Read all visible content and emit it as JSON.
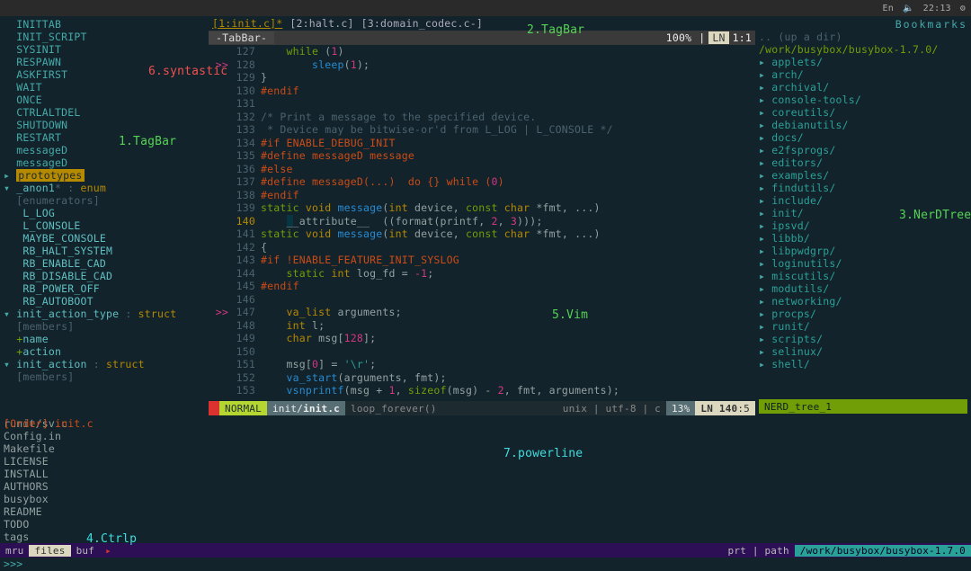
{
  "topbar": {
    "lang": "En",
    "vol": "🔈",
    "time": "22:13",
    "gear": "⚙"
  },
  "tabs": {
    "items": [
      "[1:init.c]*",
      "[2:halt.c]",
      "[3:domain_codec.c-]"
    ],
    "label": "-TabBar-",
    "pct": "100%",
    "ln_lbl": "LN",
    "ln_val": "1:1"
  },
  "tagbar": {
    "lines": [
      {
        "t": "  INITTAB",
        "c": "tb-macro"
      },
      {
        "t": "  INIT_SCRIPT",
        "c": "tb-macro"
      },
      {
        "t": "  SYSINIT",
        "c": "tb-macro"
      },
      {
        "t": "  RESPAWN",
        "c": "tb-macro"
      },
      {
        "t": "  ASKFIRST",
        "c": "tb-macro"
      },
      {
        "t": "  WAIT",
        "c": "tb-macro"
      },
      {
        "t": "  ONCE",
        "c": "tb-macro"
      },
      {
        "t": "  CTRLALTDEL",
        "c": "tb-macro"
      },
      {
        "t": "  SHUTDOWN",
        "c": "tb-macro"
      },
      {
        "t": "  RESTART",
        "c": "tb-macro"
      },
      {
        "t": "  messageD",
        "c": "tb-macro"
      },
      {
        "t": "  messageD",
        "c": "tb-macro"
      },
      {
        "sel": "prototypes",
        "pre": "▸ "
      },
      {
        "raw": [
          {
            "t": "▾ ",
            "c": "tb-arrow"
          },
          {
            "t": "_anon1",
            "c": "tb-name"
          },
          {
            "t": "* : ",
            "c": "tb-muted"
          },
          {
            "t": "enum",
            "c": "tb-type"
          }
        ]
      },
      {
        "t": "  [enumerators]",
        "c": "tb-muted"
      },
      {
        "t": "   L_LOG",
        "c": "tb-name"
      },
      {
        "t": "   L_CONSOLE",
        "c": "tb-name"
      },
      {
        "t": "   MAYBE_CONSOLE",
        "c": "tb-name"
      },
      {
        "t": "   RB_HALT_SYSTEM",
        "c": "tb-name"
      },
      {
        "t": "   RB_ENABLE_CAD",
        "c": "tb-name"
      },
      {
        "t": "   RB_DISABLE_CAD",
        "c": "tb-name"
      },
      {
        "t": "   RB_POWER_OFF",
        "c": "tb-name"
      },
      {
        "t": "   RB_AUTOBOOT",
        "c": "tb-name"
      },
      {
        "raw": [
          {
            "t": "▾ ",
            "c": "tb-arrow"
          },
          {
            "t": "init_action_type",
            "c": "tb-name"
          },
          {
            "t": " : ",
            "c": "tb-muted"
          },
          {
            "t": "struct",
            "c": "tb-type"
          }
        ]
      },
      {
        "t": "  [members]",
        "c": "tb-muted"
      },
      {
        "raw": [
          {
            "t": "  +",
            "c": "tb-plus"
          },
          {
            "t": "name",
            "c": "tb-name"
          }
        ]
      },
      {
        "raw": [
          {
            "t": "  +",
            "c": "tb-plus"
          },
          {
            "t": "action",
            "c": "tb-name"
          }
        ]
      },
      {
        "raw": [
          {
            "t": "▾ ",
            "c": "tb-arrow"
          },
          {
            "t": "init_action",
            "c": "tb-name"
          },
          {
            "t": " : ",
            "c": "tb-muted"
          },
          {
            "t": "struct",
            "c": "tb-type"
          }
        ]
      },
      {
        "t": "  [members]",
        "c": "tb-muted"
      }
    ],
    "status": "[Order] init.c"
  },
  "code": {
    "lines": [
      {
        "m": "",
        "n": "127",
        "seg": [
          {
            "c": "tk-pl",
            "t": "    "
          },
          {
            "c": "tk-kw",
            "t": "while"
          },
          {
            "c": "tk-pl",
            "t": " ("
          },
          {
            "c": "tk-nm",
            "t": "1"
          },
          {
            "c": "tk-pl",
            "t": ")"
          }
        ]
      },
      {
        "m": ">>",
        "n": "128",
        "seg": [
          {
            "c": "tk-pl",
            "t": "        "
          },
          {
            "c": "tk-fn",
            "t": "sleep"
          },
          {
            "c": "tk-pl",
            "t": "("
          },
          {
            "c": "tk-nm",
            "t": "1"
          },
          {
            "c": "tk-pl",
            "t": ");"
          }
        ]
      },
      {
        "m": "",
        "n": "129",
        "seg": [
          {
            "c": "tk-pl",
            "t": "}"
          }
        ]
      },
      {
        "m": "",
        "n": "130",
        "seg": [
          {
            "c": "tk-pp",
            "t": "#endif"
          }
        ]
      },
      {
        "m": "",
        "n": "131",
        "seg": []
      },
      {
        "m": "",
        "n": "132",
        "seg": [
          {
            "c": "tk-cm",
            "t": "/* Print a message to the specified device."
          }
        ]
      },
      {
        "m": "",
        "n": "133",
        "seg": [
          {
            "c": "tk-cm",
            "t": " * Device may be bitwise-or'd from L_LOG | L_CONSOLE */"
          }
        ]
      },
      {
        "m": "",
        "n": "134",
        "seg": [
          {
            "c": "tk-pp",
            "t": "#if ENABLE_DEBUG_INIT"
          }
        ]
      },
      {
        "m": "",
        "n": "135",
        "seg": [
          {
            "c": "tk-pp",
            "t": "#define messageD message"
          }
        ]
      },
      {
        "m": "",
        "n": "136",
        "seg": [
          {
            "c": "tk-pp",
            "t": "#else"
          }
        ]
      },
      {
        "m": "",
        "n": "137",
        "seg": [
          {
            "c": "tk-pp",
            "t": "#define messageD(...)  do {} while ("
          },
          {
            "c": "tk-nm",
            "t": "0"
          },
          {
            "c": "tk-pp",
            "t": ")"
          }
        ]
      },
      {
        "m": "",
        "n": "138",
        "seg": [
          {
            "c": "tk-pp",
            "t": "#endif"
          }
        ]
      },
      {
        "m": "",
        "n": "139",
        "seg": [
          {
            "c": "tk-kw",
            "t": "static "
          },
          {
            "c": "tk-ty",
            "t": "void "
          },
          {
            "c": "tk-fn",
            "t": "message"
          },
          {
            "c": "tk-pl",
            "t": "("
          },
          {
            "c": "tk-ty",
            "t": "int"
          },
          {
            "c": "tk-pl",
            "t": " device, "
          },
          {
            "c": "tk-kw",
            "t": "const "
          },
          {
            "c": "tk-ty",
            "t": "char"
          },
          {
            "c": "tk-pl",
            "t": " *fmt, ...)"
          }
        ]
      },
      {
        "m": "",
        "n": "140",
        "seg": [
          {
            "c": "tk-pl",
            "t": "    "
          },
          {
            "c": "cursor-bg",
            "t": "_"
          },
          {
            "c": "tk-pl",
            "t": "_attribute__  ((format(printf, "
          },
          {
            "c": "tk-nm",
            "t": "2"
          },
          {
            "c": "tk-pl",
            "t": ", "
          },
          {
            "c": "tk-nm",
            "t": "3"
          },
          {
            "c": "tk-pl",
            "t": ")));"
          }
        ],
        "cur": true
      },
      {
        "m": "",
        "n": "141",
        "seg": [
          {
            "c": "tk-kw",
            "t": "static "
          },
          {
            "c": "tk-ty",
            "t": "void "
          },
          {
            "c": "tk-fn",
            "t": "message"
          },
          {
            "c": "tk-pl",
            "t": "("
          },
          {
            "c": "tk-ty",
            "t": "int"
          },
          {
            "c": "tk-pl",
            "t": " device, "
          },
          {
            "c": "tk-kw",
            "t": "const "
          },
          {
            "c": "tk-ty",
            "t": "char"
          },
          {
            "c": "tk-pl",
            "t": " *fmt, ...)"
          }
        ]
      },
      {
        "m": "",
        "n": "142",
        "seg": [
          {
            "c": "tk-pl",
            "t": "{"
          }
        ]
      },
      {
        "m": "",
        "n": "143",
        "seg": [
          {
            "c": "tk-pp",
            "t": "#if !ENABLE_FEATURE_INIT_SYSLOG"
          }
        ]
      },
      {
        "m": "",
        "n": "144",
        "seg": [
          {
            "c": "tk-pl",
            "t": "    "
          },
          {
            "c": "tk-kw",
            "t": "static "
          },
          {
            "c": "tk-ty",
            "t": "int"
          },
          {
            "c": "tk-pl",
            "t": " log_fd = "
          },
          {
            "c": "tk-nm",
            "t": "-1"
          },
          {
            "c": "tk-pl",
            "t": ";"
          }
        ]
      },
      {
        "m": "",
        "n": "145",
        "seg": [
          {
            "c": "tk-pp",
            "t": "#endif"
          }
        ]
      },
      {
        "m": "",
        "n": "146",
        "seg": []
      },
      {
        "m": ">>",
        "n": "147",
        "seg": [
          {
            "c": "tk-pl",
            "t": "    "
          },
          {
            "c": "tk-ty",
            "t": "va_list"
          },
          {
            "c": "tk-pl",
            "t": " arguments;"
          }
        ]
      },
      {
        "m": "",
        "n": "148",
        "seg": [
          {
            "c": "tk-pl",
            "t": "    "
          },
          {
            "c": "tk-ty",
            "t": "int"
          },
          {
            "c": "tk-pl",
            "t": " l;"
          }
        ]
      },
      {
        "m": "",
        "n": "149",
        "seg": [
          {
            "c": "tk-pl",
            "t": "    "
          },
          {
            "c": "tk-ty",
            "t": "char"
          },
          {
            "c": "tk-pl",
            "t": " msg["
          },
          {
            "c": "tk-nm",
            "t": "128"
          },
          {
            "c": "tk-pl",
            "t": "];"
          }
        ]
      },
      {
        "m": "",
        "n": "150",
        "seg": []
      },
      {
        "m": "",
        "n": "151",
        "seg": [
          {
            "c": "tk-pl",
            "t": "    msg["
          },
          {
            "c": "tk-nm",
            "t": "0"
          },
          {
            "c": "tk-pl",
            "t": "] = "
          },
          {
            "c": "tk-ch",
            "t": "'\\r'"
          },
          {
            "c": "tk-pl",
            "t": ";"
          }
        ]
      },
      {
        "m": "",
        "n": "152",
        "seg": [
          {
            "c": "tk-pl",
            "t": "    "
          },
          {
            "c": "tk-fn",
            "t": "va_start"
          },
          {
            "c": "tk-pl",
            "t": "(arguments, fmt);"
          }
        ]
      },
      {
        "m": "",
        "n": "153",
        "seg": [
          {
            "c": "tk-pl",
            "t": "    "
          },
          {
            "c": "tk-fn",
            "t": "vsnprintf"
          },
          {
            "c": "tk-pl",
            "t": "(msg + "
          },
          {
            "c": "tk-nm",
            "t": "1"
          },
          {
            "c": "tk-pl",
            "t": ", "
          },
          {
            "c": "tk-kw",
            "t": "sizeof"
          },
          {
            "c": "tk-pl",
            "t": "(msg) - "
          },
          {
            "c": "tk-nm",
            "t": "2"
          },
          {
            "c": "tk-pl",
            "t": ", fmt, arguments);"
          }
        ]
      }
    ]
  },
  "statusline": {
    "mode": "NORMAL",
    "file_dir": "init/",
    "file_name": "init.c",
    "func": "loop_forever()",
    "enc": "unix | utf-8 | c",
    "pct": "13%",
    "ln_lbl": "LN 140",
    "ln_col": ":5",
    "nerd": "NERD_tree_1"
  },
  "nerdtree": {
    "title": "Bookmarks",
    "up": ".. (up a dir)",
    "root": "/work/busybox/busybox-1.7.0/",
    "dirs": [
      "applets/",
      "arch/",
      "archival/",
      "console-tools/",
      "coreutils/",
      "debianutils/",
      "docs/",
      "e2fsprogs/",
      "editors/",
      "examples/",
      "findutils/",
      "include/",
      "init/",
      "ipsvd/",
      "libbb/",
      "libpwdgrp/",
      "loginutils/",
      "miscutils/",
      "modutils/",
      "networking/",
      "procps/",
      "runit/",
      "scripts/",
      "selinux/",
      "shell/"
    ]
  },
  "ctrlp": {
    "header": "  runit/sv.c",
    "items": [
      "  Config.in",
      "  Makefile",
      "  LICENSE",
      "  INSTALL",
      "  AUTHORS",
      "  busybox",
      "  README",
      "  TODO",
      "  tags"
    ],
    "modes": [
      "mru",
      "files",
      "buf"
    ],
    "arrow": "▸",
    "right_lbl": "prt | path",
    "path": "/work/busybox/busybox-1.7.0"
  },
  "cmd": ">>>",
  "ann": {
    "a1": "1.TagBar",
    "a2": "2.TagBar",
    "a3": "3.NerDTree",
    "a4": "4.Ctrlp",
    "a5": "5.Vim",
    "a6": "6.syntastic",
    "a7": "7.powerline"
  }
}
